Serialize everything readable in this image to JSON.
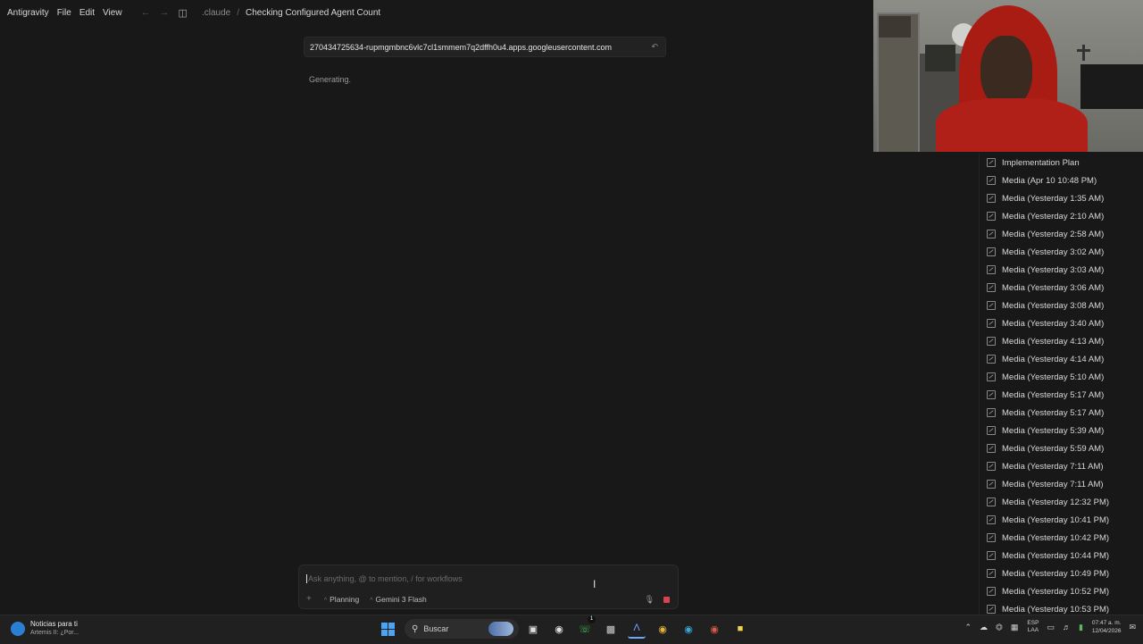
{
  "titlebar": {
    "app": "Antigravity",
    "menu": [
      "File",
      "Edit",
      "View"
    ],
    "breadcrumb_folder": ".claude",
    "breadcrumb_title": "Checking Configured Agent Count"
  },
  "conversation": {
    "user_query": "270434725634-rupmgmbnc6vlc7cl1smmem7q2dffh0u4.apps.googleusercontent.com",
    "status": "Generating."
  },
  "right_list": [
    "Implementation Plan",
    "Media (Apr 10 10:48 PM)",
    "Media (Yesterday 1:35 AM)",
    "Media (Yesterday 2:10 AM)",
    "Media (Yesterday 2:58 AM)",
    "Media (Yesterday 3:02 AM)",
    "Media (Yesterday 3:03 AM)",
    "Media (Yesterday 3:06 AM)",
    "Media (Yesterday 3:08 AM)",
    "Media (Yesterday 3:40 AM)",
    "Media (Yesterday 4:13 AM)",
    "Media (Yesterday 4:14 AM)",
    "Media (Yesterday 5:10 AM)",
    "Media (Yesterday 5:17 AM)",
    "Media (Yesterday 5:17 AM)",
    "Media (Yesterday 5:39 AM)",
    "Media (Yesterday 5:59 AM)",
    "Media (Yesterday 7:11 AM)",
    "Media (Yesterday 7:11 AM)",
    "Media (Yesterday 12:32 PM)",
    "Media (Yesterday 10:41 PM)",
    "Media (Yesterday 10:42 PM)",
    "Media (Yesterday 10:44 PM)",
    "Media (Yesterday 10:49 PM)",
    "Media (Yesterday 10:52 PM)",
    "Media (Yesterday 10:53 PM)"
  ],
  "chat_input": {
    "placeholder": "Ask anything, @ to mention, / for workflows",
    "mode": "Planning",
    "model": "Gemini 3 Flash"
  },
  "taskbar": {
    "news_title": "Noticias para ti",
    "news_sub": "Artemis II: ¿Por...",
    "search_label": "Buscar",
    "lang_top": "ESP",
    "lang_bottom": "LAA",
    "time": "07:47 a. m.",
    "date": "12/04/2026",
    "badge_count": "1"
  },
  "colors": {
    "background": "#181818",
    "stop_button": "#d9434e",
    "start_icon": "#4ba3f2"
  }
}
